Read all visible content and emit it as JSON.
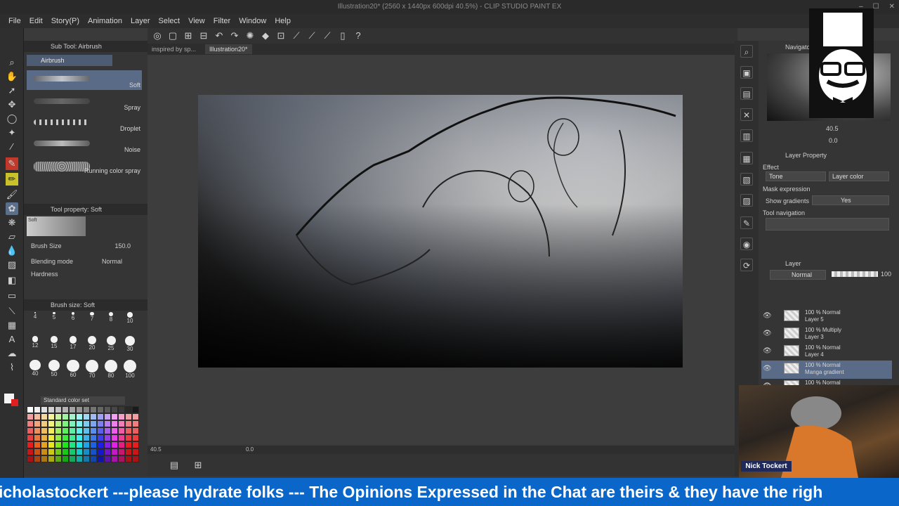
{
  "window": {
    "title": "Illustration20* (2560 x 1440px 600dpi 40.5%) - CLIP STUDIO PAINT EX"
  },
  "menu": [
    "File",
    "Edit",
    "Story(P)",
    "Animation",
    "Layer",
    "Select",
    "View",
    "Filter",
    "Window",
    "Help"
  ],
  "doc_tabs": [
    "inspired by sp...",
    "Illustration20*"
  ],
  "subtool": {
    "header": "Sub Tool: Airbrush",
    "tab": "Airbrush",
    "items": [
      "Soft",
      "Spray",
      "Droplet",
      "Noise",
      "Running color spray"
    ],
    "selected": "Soft"
  },
  "tool_property": {
    "header": "Tool property: Soft",
    "preview_label": "Soft",
    "brush_size_label": "Brush Size",
    "brush_size_value": "150.0",
    "blending_label": "Blending mode",
    "blending_value": "Normal",
    "hardness_label": "Hardness"
  },
  "brush_size_panel": {
    "header": "Brush size: Soft",
    "sizes": [
      "4",
      "5",
      "6",
      "7",
      "8",
      "10",
      "12",
      "15",
      "17",
      "20",
      "25",
      "30",
      "40",
      "50",
      "60",
      "70",
      "80",
      "100"
    ]
  },
  "color_set": {
    "header": "Standard color set"
  },
  "status": {
    "zoom": "40.5",
    "rotation": "0.0"
  },
  "navigator": {
    "header": "Navigator",
    "zoom": "40.5",
    "angle": "0.0"
  },
  "layer_property": {
    "header": "Layer Property",
    "effect_label": "Effect",
    "tone_button": "Tone",
    "layer_color_button": "Layer color",
    "mask_label": "Mask expression",
    "show_gradients_label": "Show gradients",
    "show_gradients_value": "Yes",
    "tool_nav_label": "Tool navigation"
  },
  "layer_panel": {
    "header": "Layer",
    "blend_mode": "Normal",
    "opacity": "100",
    "layers": [
      {
        "mode": "100 % Normal",
        "name": "Layer 5"
      },
      {
        "mode": "100 % Multiply",
        "name": "Layer 3"
      },
      {
        "mode": "100 % Normal",
        "name": "Layer 4"
      },
      {
        "mode": "100 % Normal",
        "name": "Manga gradient"
      },
      {
        "mode": "100 % Normal",
        "name": ""
      }
    ],
    "selected_index": 3
  },
  "stream": {
    "name_tag": "Nick Tockert",
    "ticker": "icholastockert ---please hydrate folks --- The Opinions Expressed in the Chat are theirs & they have the righ"
  },
  "colors": {
    "accent": "#5a6b87",
    "ticker_bg": "#0a67c9",
    "nametag_bg": "#1f2a5a"
  }
}
